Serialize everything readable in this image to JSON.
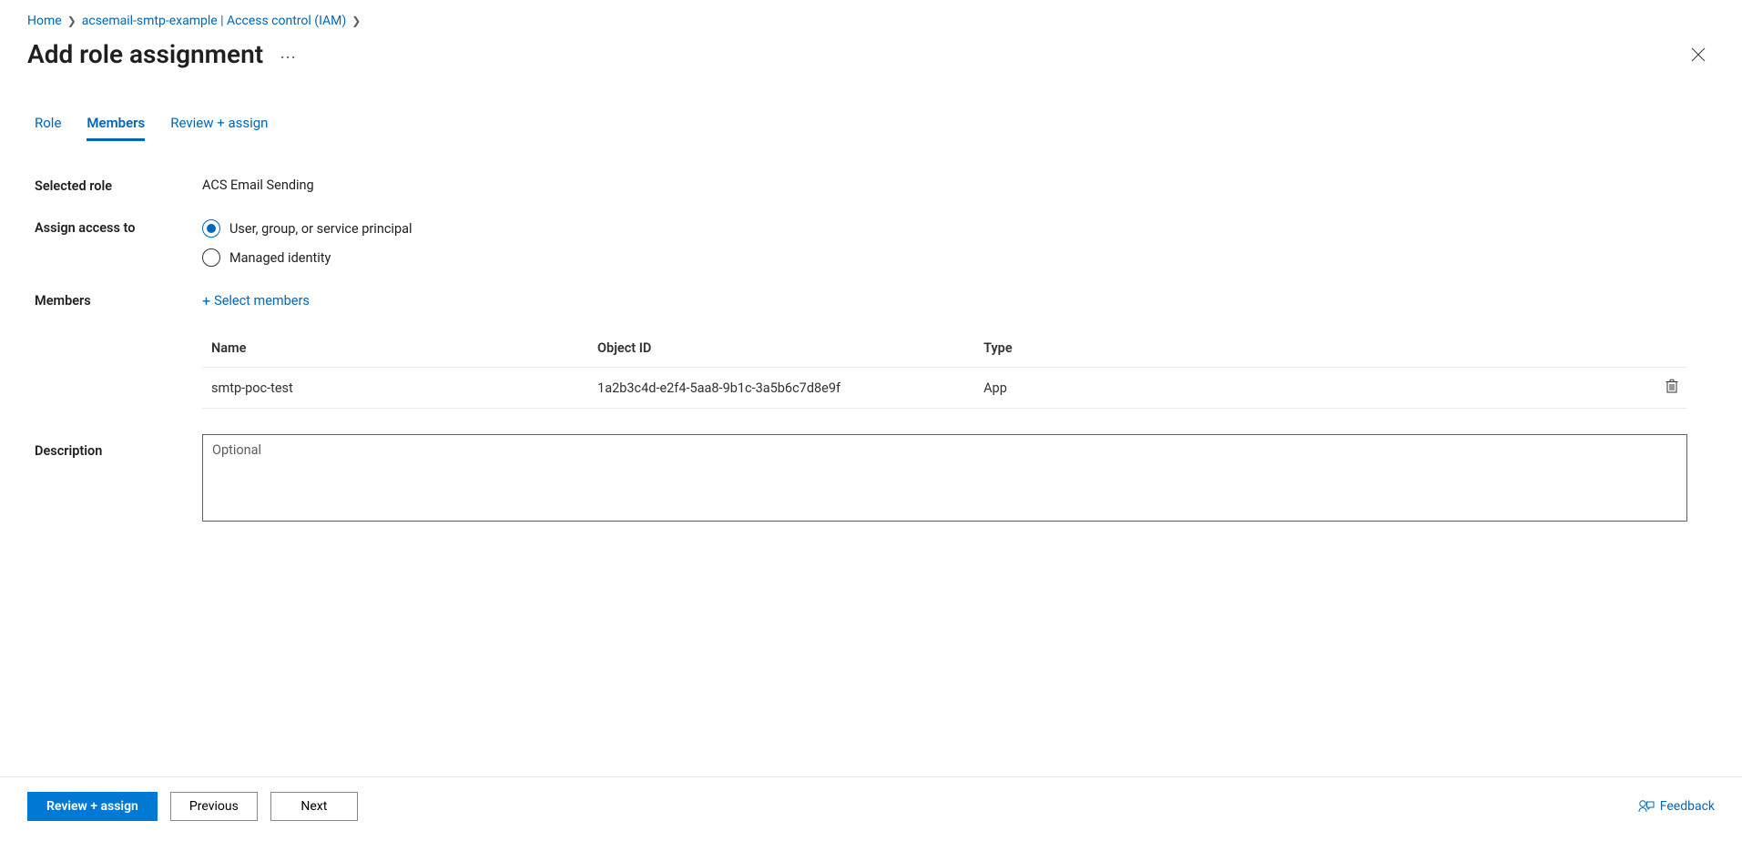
{
  "breadcrumb": {
    "home": "Home",
    "resource": "acsemail-smtp-example | Access control (IAM)"
  },
  "page": {
    "title": "Add role assignment"
  },
  "tabs": {
    "role": "Role",
    "members": "Members",
    "review": "Review + assign"
  },
  "form": {
    "selected_role_label": "Selected role",
    "selected_role_value": "ACS Email Sending",
    "assign_access_label": "Assign access to",
    "radio_user_label": "User, group, or service principal",
    "radio_managed_label": "Managed identity",
    "members_label": "Members",
    "select_members_link": "Select members",
    "description_label": "Description",
    "description_placeholder": "Optional"
  },
  "table": {
    "headers": {
      "name": "Name",
      "object_id": "Object ID",
      "type": "Type"
    },
    "rows": [
      {
        "name": "smtp-poc-test",
        "object_id": "1a2b3c4d-e2f4-5aa8-9b1c-3a5b6c7d8e9f",
        "type": "App"
      }
    ]
  },
  "footer": {
    "review": "Review + assign",
    "previous": "Previous",
    "next": "Next",
    "feedback": "Feedback"
  }
}
